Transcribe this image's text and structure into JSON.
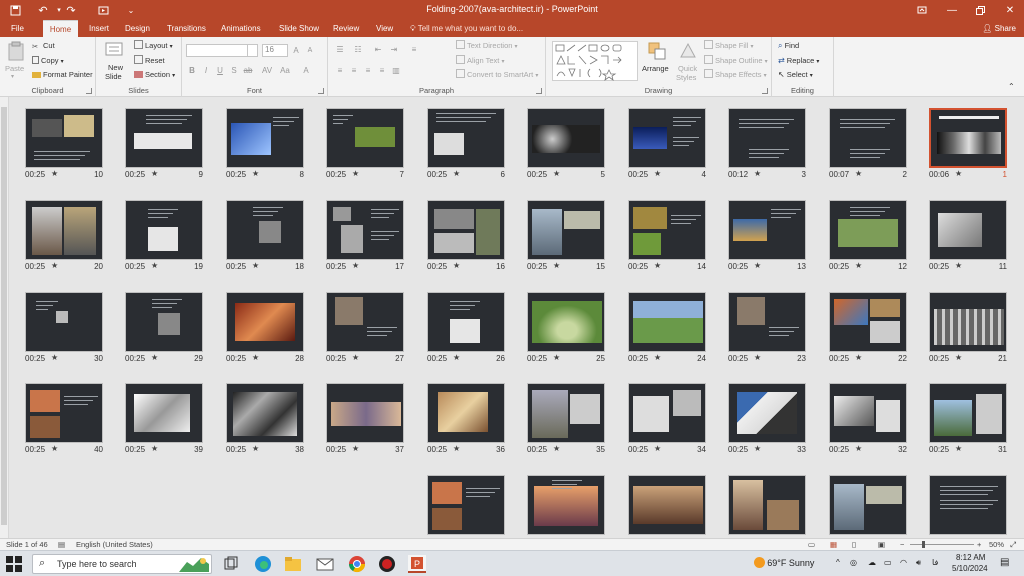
{
  "window": {
    "title": "Folding-2007(ava-architect.ir)  -  PowerPoint"
  },
  "tabs": [
    "File",
    "Home",
    "Insert",
    "Design",
    "Transitions",
    "Animations",
    "Slide Show",
    "Review",
    "View"
  ],
  "tellme": "Tell me what you want to do...",
  "share_label": "Share",
  "ribbon": {
    "clipboard": {
      "label": "Clipboard",
      "paste": "Paste",
      "cut": "Cut",
      "copy": "Copy",
      "format_painter": "Format Painter"
    },
    "slides": {
      "label": "Slides",
      "new_slide_1": "New",
      "new_slide_2": "Slide",
      "layout": "Layout",
      "reset": "Reset",
      "section": "Section"
    },
    "font": {
      "label": "Font",
      "font_name": "",
      "font_size": "16"
    },
    "paragraph": {
      "label": "Paragraph",
      "text_direction": "Text Direction",
      "align_text": "Align Text",
      "smartart": "Convert to SmartArt"
    },
    "drawing": {
      "label": "Drawing",
      "arrange": "Arrange",
      "quick_styles_1": "Quick",
      "quick_styles_2": "Styles",
      "shape_fill": "Shape Fill",
      "shape_outline": "Shape Outline",
      "shape_effects": "Shape Effects"
    },
    "editing": {
      "label": "Editing",
      "find": "Find",
      "replace": "Replace",
      "select": "Select"
    }
  },
  "slides": [
    {
      "n": "1",
      "time": "00:06",
      "theme": "title-img",
      "selected": true
    },
    {
      "n": "2",
      "time": "00:07",
      "theme": "title"
    },
    {
      "n": "3",
      "time": "00:12",
      "theme": "title"
    },
    {
      "n": "4",
      "time": "00:25",
      "theme": "night-text"
    },
    {
      "n": "5",
      "time": "00:25",
      "theme": "spheres"
    },
    {
      "n": "6",
      "time": "00:25",
      "theme": "sketch-text"
    },
    {
      "n": "7",
      "time": "00:25",
      "theme": "green-block"
    },
    {
      "n": "8",
      "time": "00:25",
      "theme": "blue-arch"
    },
    {
      "n": "9",
      "time": "00:25",
      "theme": "white-form"
    },
    {
      "n": "10",
      "time": "00:25",
      "theme": "collage"
    },
    {
      "n": "11",
      "time": "00:25",
      "theme": "grey-arch"
    },
    {
      "n": "12",
      "time": "00:25",
      "theme": "aerial-green"
    },
    {
      "n": "13",
      "time": "00:25",
      "theme": "landscape-text"
    },
    {
      "n": "14",
      "time": "00:25",
      "theme": "nature-collage"
    },
    {
      "n": "15",
      "time": "00:25",
      "theme": "city-collage"
    },
    {
      "n": "16",
      "time": "00:25",
      "theme": "bw-collage"
    },
    {
      "n": "17",
      "time": "00:25",
      "theme": "portraits"
    },
    {
      "n": "18",
      "time": "00:25",
      "theme": "portrait"
    },
    {
      "n": "19",
      "time": "00:25",
      "theme": "portrait-white"
    },
    {
      "n": "20",
      "time": "00:25",
      "theme": "interior"
    },
    {
      "n": "21",
      "time": "00:25",
      "theme": "steel-frame"
    },
    {
      "n": "22",
      "time": "00:25",
      "theme": "color-collage"
    },
    {
      "n": "23",
      "time": "00:25",
      "theme": "portrait-text"
    },
    {
      "n": "24",
      "time": "00:25",
      "theme": "green-building"
    },
    {
      "n": "25",
      "time": "00:25",
      "theme": "green-mound"
    },
    {
      "n": "26",
      "time": "00:25",
      "theme": "portrait-white"
    },
    {
      "n": "27",
      "time": "00:25",
      "theme": "portrait-text"
    },
    {
      "n": "28",
      "time": "00:25",
      "theme": "red-building"
    },
    {
      "n": "29",
      "time": "00:25",
      "theme": "portrait"
    },
    {
      "n": "30",
      "time": "00:25",
      "theme": "portrait-small"
    },
    {
      "n": "31",
      "time": "00:25",
      "theme": "mountain-arch"
    },
    {
      "n": "32",
      "time": "00:25",
      "theme": "arch-sketch"
    },
    {
      "n": "33",
      "time": "00:25",
      "theme": "blue-curve"
    },
    {
      "n": "34",
      "time": "00:25",
      "theme": "white-arch"
    },
    {
      "n": "35",
      "time": "00:25",
      "theme": "bridge"
    },
    {
      "n": "36",
      "time": "00:25",
      "theme": "wood-folds"
    },
    {
      "n": "37",
      "time": "00:25",
      "theme": "city-panorama"
    },
    {
      "n": "38",
      "time": "00:25",
      "theme": "model"
    },
    {
      "n": "39",
      "time": "00:25",
      "theme": "white-folds"
    },
    {
      "n": "40",
      "time": "00:25",
      "theme": "warm-collage"
    },
    {
      "n": "",
      "time": "",
      "theme": "text-only"
    },
    {
      "n": "",
      "time": "",
      "theme": "city-collage"
    },
    {
      "n": "",
      "time": "",
      "theme": "arch-interior"
    },
    {
      "n": "",
      "time": "",
      "theme": "warm-city"
    },
    {
      "n": "",
      "time": "",
      "theme": "sunset"
    },
    {
      "n": "",
      "time": "",
      "theme": "warm-collage"
    }
  ],
  "status": {
    "slide_of": "Slide 1 of 46",
    "language": "English (United States)",
    "zoom": "50%"
  },
  "taskbar": {
    "search_placeholder": "Type here to search",
    "weather": "69°F  Sunny",
    "time": "8:12 AM",
    "date": "5/10/2024"
  },
  "colors": {
    "accent": "#b7472a",
    "selected": "#d35230"
  }
}
